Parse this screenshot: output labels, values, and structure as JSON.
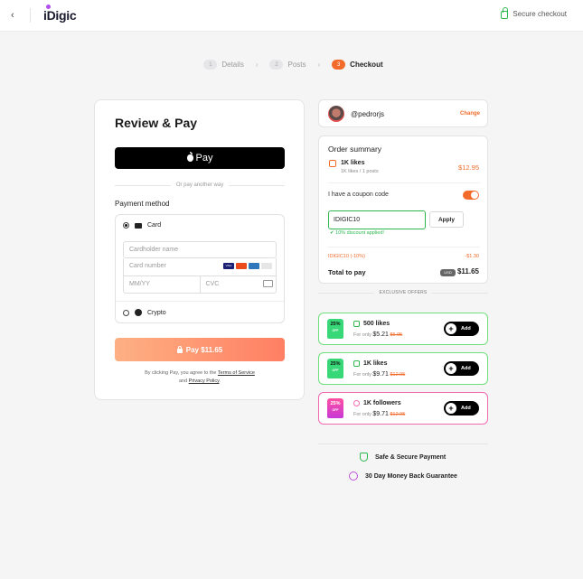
{
  "header": {
    "back_icon": "‹",
    "logo": "iDigic",
    "secure_label": "Secure checkout"
  },
  "steps": [
    {
      "num": "1",
      "label": "Details",
      "active": false
    },
    {
      "num": "2",
      "label": "Posts",
      "active": false
    },
    {
      "num": "3",
      "label": "Checkout",
      "active": true
    }
  ],
  "review": {
    "title": "Review & Pay",
    "apple_pay_label": "Pay",
    "or_text": "Or pay another way",
    "payment_method_label": "Payment method",
    "card_label": "Card",
    "cardholder_placeholder": "Cardholder name",
    "card_number_placeholder": "Card number",
    "expiry_placeholder": "MM/YY",
    "cvc_placeholder": "CVC",
    "crypto_label": "Crypto",
    "pay_button": "Pay $11.65",
    "terms_prefix": "By clicking Pay, you agree to the",
    "terms_link": "Terms of Service",
    "terms_and": "and",
    "privacy_link": "Privacy Policy",
    "terms_end": "."
  },
  "user": {
    "username": "@pedrorjs",
    "change_label": "Change"
  },
  "summary": {
    "title": "Order summary",
    "item_title": "1K likes",
    "item_sub": "1K likes / 1 posts",
    "item_price": "$12.95",
    "coupon_label": "I have a coupon code",
    "coupon_value": "IDIGIC10",
    "apply_label": "Apply",
    "discount_applied": "✔ 10% discount applied!",
    "discount_line": "IDIGIC10 (-10%)",
    "discount_value": "-$1.30",
    "total_label": "Total to pay",
    "currency": "USD",
    "total_value": "$11.65"
  },
  "offers_header": "EXCLUSIVE OFFERS",
  "offers": [
    {
      "badge": "25%",
      "badge_sub": "OFF",
      "title": "500 likes",
      "for_only": "For only",
      "price": "$5.21",
      "old_price": "$6.95",
      "add": "Add",
      "color": "#6ee07a"
    },
    {
      "badge": "25%",
      "badge_sub": "OFF",
      "title": "1K likes",
      "for_only": "For only",
      "price": "$9.71",
      "old_price": "$12.95",
      "add": "Add",
      "color": "#6ee07a"
    },
    {
      "badge": "25%",
      "badge_sub": "OFF",
      "title": "1K followers",
      "for_only": "For only",
      "price": "$9.71",
      "old_price": "$12.95",
      "add": "Add",
      "color": "#f16ab0"
    }
  ],
  "guarantees": {
    "safe": "Safe & Secure Payment",
    "money_back": "30 Day Money Back Guarantee"
  }
}
